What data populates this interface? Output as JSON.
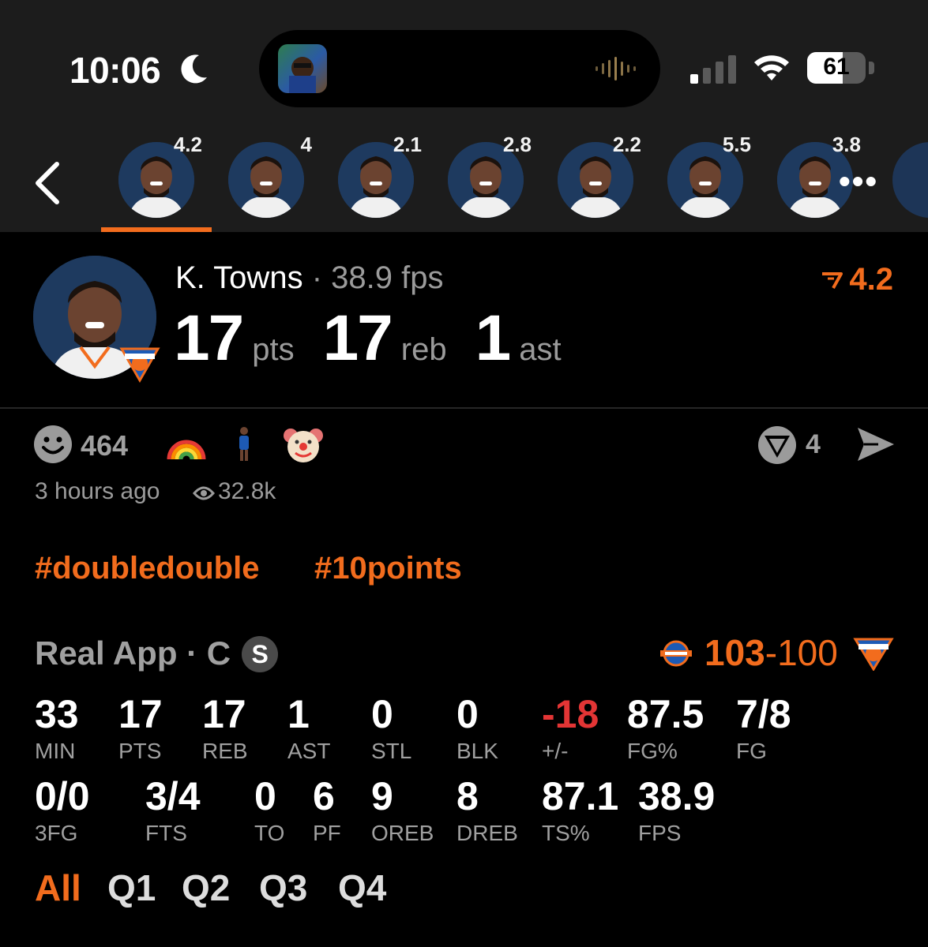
{
  "status_bar": {
    "time": "10:06",
    "battery_level": "61",
    "battery_fraction": 0.61
  },
  "player_strip": {
    "scores": [
      "4.2",
      "4",
      "2.1",
      "2.8",
      "2.2",
      "5.5",
      "3.8"
    ],
    "selected_index": 0
  },
  "header": {
    "name": "K. Towns",
    "separator": "·",
    "fps": "38.9 fps",
    "rating": "4.2",
    "pts": "17",
    "pts_unit": "pts",
    "reb": "17",
    "reb_unit": "reb",
    "ast": "1",
    "ast_unit": "ast"
  },
  "reactions": {
    "count": "464",
    "votes": "4",
    "time_ago": "3 hours ago",
    "views": "32.8k"
  },
  "tags": [
    "#doubledouble",
    "#10points"
  ],
  "game": {
    "source": "Real App · C",
    "badge": "S",
    "score_win": "103",
    "score_sep": "-",
    "score_loss": "100"
  },
  "stats_row1": [
    {
      "value": "33",
      "label": "MIN"
    },
    {
      "value": "17",
      "label": "PTS"
    },
    {
      "value": "17",
      "label": "REB"
    },
    {
      "value": "1",
      "label": "AST"
    },
    {
      "value": "0",
      "label": "STL"
    },
    {
      "value": "0",
      "label": "BLK"
    },
    {
      "value": "-18",
      "label": "+/-"
    },
    {
      "value": "87.5",
      "label": "FG%"
    },
    {
      "value": "7/8",
      "label": "FG"
    }
  ],
  "stats_row2": [
    {
      "value": "0/0",
      "label": "3FG"
    },
    {
      "value": "3/4",
      "label": "FTS"
    },
    {
      "value": "0",
      "label": "TO"
    },
    {
      "value": "6",
      "label": "PF"
    },
    {
      "value": "9",
      "label": "OREB"
    },
    {
      "value": "8",
      "label": "DREB"
    },
    {
      "value": "87.1",
      "label": "TS%"
    },
    {
      "value": "38.9",
      "label": "FPS"
    }
  ],
  "quarter_tabs": [
    "All",
    "Q1",
    "Q2",
    "Q3",
    "Q4"
  ],
  "colors": {
    "accent": "#f26c1d",
    "negative": "#e33535",
    "muted": "#9b9b9b"
  }
}
